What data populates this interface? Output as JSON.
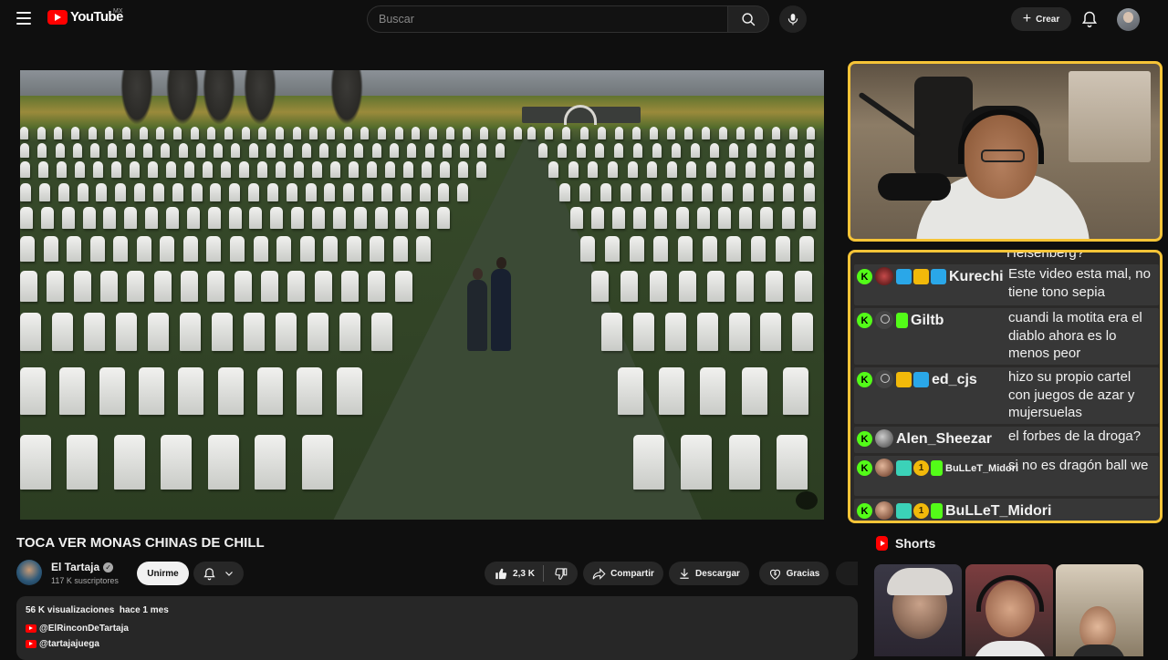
{
  "header": {
    "logo_text": "YouTube",
    "region": "MX",
    "search_placeholder": "Buscar",
    "create_label": "Crear"
  },
  "video": {
    "title": "TOCA VER MONAS CHINAS DE CHILL"
  },
  "channel": {
    "name": "El Tartaja",
    "verified_mark": "✓",
    "subscribers": "117 K suscriptores",
    "join_label": "Unirme"
  },
  "actions": {
    "likes": "2,3 K",
    "share_label": "Compartir",
    "download_label": "Descargar",
    "thanks_label": "Gracias"
  },
  "description": {
    "views": "56 K visualizaciones",
    "date": "hace 1 mes",
    "links": [
      "@ElRinconDeTartaja",
      "@tartajajuega"
    ]
  },
  "chat": {
    "cut_text": "Heisenberg?",
    "messages": [
      {
        "user": "Kurechi",
        "badges": [
          "blue",
          "crown",
          "bear"
        ],
        "avatar": "red",
        "text": "Este video esta mal, no tiene tono sepia"
      },
      {
        "user": "Giltb",
        "badges": [
          "green"
        ],
        "avatar": "dark",
        "text": "cuandi la motita era el diablo ahora es lo menos peor"
      },
      {
        "user": "ed_cjs",
        "badges": [
          "crown",
          "bear"
        ],
        "avatar": "dark",
        "text": "hizo su propio cartel con juegos de azar y mujersuelas"
      },
      {
        "user": "Alen_Sheezar",
        "badges": [],
        "avatar": "grey",
        "text": "el forbes de la droga?"
      },
      {
        "user": "BuLLeT_Midori",
        "badges": [
          "hex",
          "1",
          "green"
        ],
        "avatar": "bull",
        "text": "si no es dragón ball we"
      },
      {
        "user": "BuLLeT_Midori",
        "badges": [
          "hex",
          "1",
          "green"
        ],
        "avatar": "bull",
        "text": ""
      }
    ]
  },
  "shorts": {
    "title": "Shorts"
  }
}
